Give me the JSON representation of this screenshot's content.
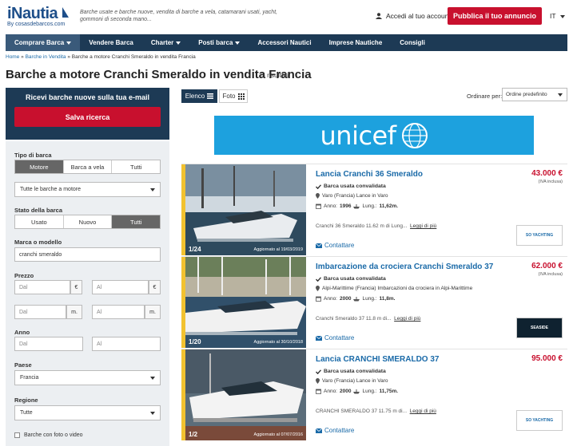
{
  "header": {
    "logo_text": "iNautia",
    "logo_sub": "By cosasdebarcos.com",
    "tagline": "Barche usate e barche nuove, vendita di barche a vela, catamarani usati, yacht, gommoni di seconda mano...",
    "account_label": "Accedi al tuo account",
    "publish_label": "Pubblica il tuo annuncio",
    "language": "IT"
  },
  "nav": {
    "items": [
      {
        "label": "Comprare Barca",
        "has_caret": true
      },
      {
        "label": "Vendere Barca",
        "has_caret": false
      },
      {
        "label": "Charter",
        "has_caret": true
      },
      {
        "label": "Posti barca",
        "has_caret": true
      },
      {
        "label": "Accessori Nautici",
        "has_caret": false
      },
      {
        "label": "Imprese Nautiche",
        "has_caret": false
      },
      {
        "label": "Consigli",
        "has_caret": false
      }
    ]
  },
  "breadcrumb": {
    "home": "Home",
    "sep": " » ",
    "level2": "Barche in Vendita",
    "current": "Barche a motore Cranchi Smeraldo in vendita Francia"
  },
  "page": {
    "title": "Barche a motore Cranchi Smeraldo in vendita Francia",
    "results": "5 risultati"
  },
  "alert": {
    "title": "Ricevi barche nuove sulla tua e-mail",
    "save_label": "Salva ricerca"
  },
  "filters": {
    "boat_type_label": "Tipo di barca",
    "boat_type_options": [
      "Motore",
      "Barca a vela",
      "Tutti"
    ],
    "boat_subtype_value": "Tutte le barche a motore",
    "state_label": "Stato della barca",
    "state_options": [
      "Usato",
      "Nuovo",
      "Tutti"
    ],
    "brand_label": "Marca o modello",
    "brand_value": "cranchi smeraldo",
    "price_label": "Prezzo",
    "price_from": "Dal",
    "price_to": "Al",
    "currency": "€",
    "length_from": "Dal",
    "length_to": "Al",
    "length_unit": "m.",
    "year_label": "Anno",
    "year_from": "Dal",
    "year_to": "Al",
    "country_label": "Paese",
    "country_value": "Francia",
    "region_label": "Regione",
    "region_value": "Tutte",
    "photo_video_label": "Barche con foto o video"
  },
  "toolbar": {
    "list_label": "Elenco",
    "photo_label": "Foto",
    "sort_label": "Ordinare per:",
    "sort_value": "Ordine predefinito"
  },
  "ad": {
    "text": "unicef"
  },
  "listings": [
    {
      "title": "Lancia Cranchi 36 Smeraldo",
      "price": "43.000 €",
      "vat": "(IVA inclusa)",
      "verified": "Barca usata convalidata",
      "location": "Varo (Francia) Lance in Varo",
      "year_label": "Anno:",
      "year": "1996",
      "length_label": "Lung.:",
      "length": "11,62m.",
      "desc": "Cranchi 36 Smeraldo 11.62 m di Lung...",
      "more": "Leggi di più",
      "contact": "Contattare",
      "photo_count": "1/24",
      "updated": "Aggiornato al 19/03/2019",
      "dealer": "SO YACHTING"
    },
    {
      "title": "Imbarcazione da crociera Cranchi Smeraldo 37",
      "price": "62.000 €",
      "vat": "(IVA inclusa)",
      "verified": "Barca usata convalidata",
      "location": "Alpi-Marittime (Francia) Imbarcazioni da crociera in Alpi-Marittime",
      "year_label": "Anno:",
      "year": "2000",
      "length_label": "Lung.:",
      "length": "11,8m.",
      "desc": "Cranchi Smeraldo 37 11.8 m di...",
      "more": "Leggi di più",
      "contact": "Contattare",
      "photo_count": "1/20",
      "updated": "Aggiornato al 30/10/2018",
      "dealer": "SEASIDE"
    },
    {
      "title": "Lancia CRANCHI SMERALDO 37",
      "price": "95.000 €",
      "vat": "",
      "verified": "Barca usata convalidata",
      "location": "Varo (Francia) Lance in Varo",
      "year_label": "Anno:",
      "year": "2000",
      "length_label": "Lung.:",
      "length": "11,75m.",
      "desc": "CRANCHI SMERALDO 37 11.75 m di...",
      "more": "Leggi di più",
      "contact": "Contattare",
      "photo_count": "1/2",
      "updated": "Aggiornato al 07/07/2016",
      "dealer": "SO YACHTING"
    }
  ],
  "colors": {
    "navy": "#1d3a55",
    "red": "#c8102e",
    "link": "#1a6aa8",
    "stripe": "#f2c230",
    "unicef": "#1da1de"
  }
}
